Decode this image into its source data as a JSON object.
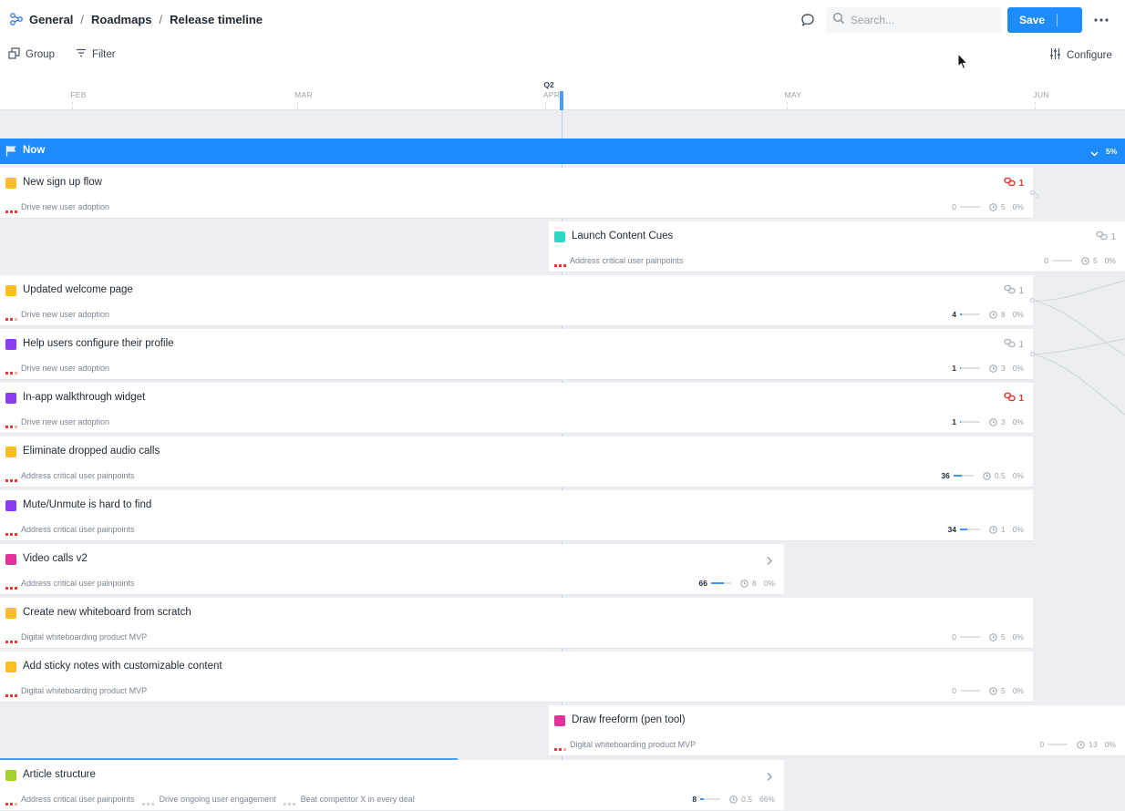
{
  "breadcrumb": {
    "items": [
      "General",
      "Roadmaps",
      "Release timeline"
    ],
    "separator": "/"
  },
  "header": {
    "search_placeholder": "Search...",
    "save_label": "Save"
  },
  "toolbar": {
    "group_label": "Group",
    "filter_label": "Filter",
    "configure_label": "Configure"
  },
  "timeline": {
    "quarter": "Q2",
    "months": [
      "FEB",
      "MAR",
      "APR",
      "MAY",
      "JUN"
    ]
  },
  "group": {
    "name": "Now",
    "progress": "5%",
    "color": "#1e8cff"
  },
  "colors": {
    "yellow": "#fbbf24",
    "teal": "#2ed8c8",
    "purple": "#8b3df0",
    "pink": "#e3339a",
    "lime": "#a5cf2d",
    "red": "#e53935"
  },
  "cards": [
    {
      "title": "New sign up flow",
      "color": "#fbbf24",
      "goals": [
        "Drive new user adoption"
      ],
      "deps": "1",
      "deps_state": "red",
      "count": "0",
      "effort": "5",
      "progress": "0%",
      "fill": 0
    },
    {
      "title": "Launch Content Cues",
      "color": "#2ed8c8",
      "goals": [
        "Address critical user painpoints"
      ],
      "deps": "1",
      "deps_state": "gray",
      "count": "0",
      "effort": "5",
      "progress": "0%",
      "fill": 0
    },
    {
      "title": "Updated welcome page",
      "color": "#fbbf24",
      "goals": [
        "Drive new user adoption"
      ],
      "deps": "1",
      "deps_state": "gray",
      "count": "4",
      "effort": "8",
      "progress": "0%",
      "fill": 0.1
    },
    {
      "title": "Help users configure their profile",
      "color": "#8b3df0",
      "goals": [
        "Drive new user adoption"
      ],
      "deps": "1",
      "deps_state": "gray",
      "count": "1",
      "effort": "3",
      "progress": "0%",
      "fill": 0.05
    },
    {
      "title": "In-app walkthrough widget",
      "color": "#8b3df0",
      "goals": [
        "Drive new user adoption"
      ],
      "deps": "1",
      "deps_state": "red",
      "count": "1",
      "effort": "3",
      "progress": "0%",
      "fill": 0.05
    },
    {
      "title": "Eliminate dropped audio calls",
      "color": "#fbbf24",
      "goals": [
        "Address critical user painpoints"
      ],
      "count": "36",
      "effort": "0.5",
      "progress": "0%",
      "fill": 0.4
    },
    {
      "title": "Mute/Unmute is hard to find",
      "color": "#8b3df0",
      "goals": [
        "Address critical user painpoints"
      ],
      "count": "34",
      "effort": "1",
      "progress": "0%",
      "fill": 0.38
    },
    {
      "title": "Video calls v2",
      "color": "#e3339a",
      "goals": [
        "Address critical user painpoints"
      ],
      "count": "66",
      "effort": "8",
      "progress": "0%",
      "fill": 0.62,
      "chevron": true
    },
    {
      "title": "Create new whiteboard from scratch",
      "color": "#fbbf24",
      "goals": [
        "Digital whiteboarding product MVP"
      ],
      "count": "0",
      "effort": "5",
      "progress": "0%",
      "fill": 0
    },
    {
      "title": "Add sticky notes with customizable content",
      "color": "#fbbf24",
      "goals": [
        "Digital whiteboarding product MVP"
      ],
      "count": "0",
      "effort": "5",
      "progress": "0%",
      "fill": 0
    },
    {
      "title": "Draw freeform (pen tool)",
      "color": "#e3339a",
      "goals": [
        "Digital whiteboarding product MVP"
      ],
      "count": "0",
      "effort": "13",
      "progress": "0%",
      "fill": 0
    },
    {
      "title": "Article structure",
      "color": "#a5cf2d",
      "goals": [
        "Address critical user painpoints",
        "Drive ongoing user engagement",
        "Beat competitor X in every deal"
      ],
      "count": "8",
      "effort": "0.5",
      "progress": "66%",
      "fill": 0.2,
      "chevron": true,
      "top_progress": 0.66
    }
  ]
}
